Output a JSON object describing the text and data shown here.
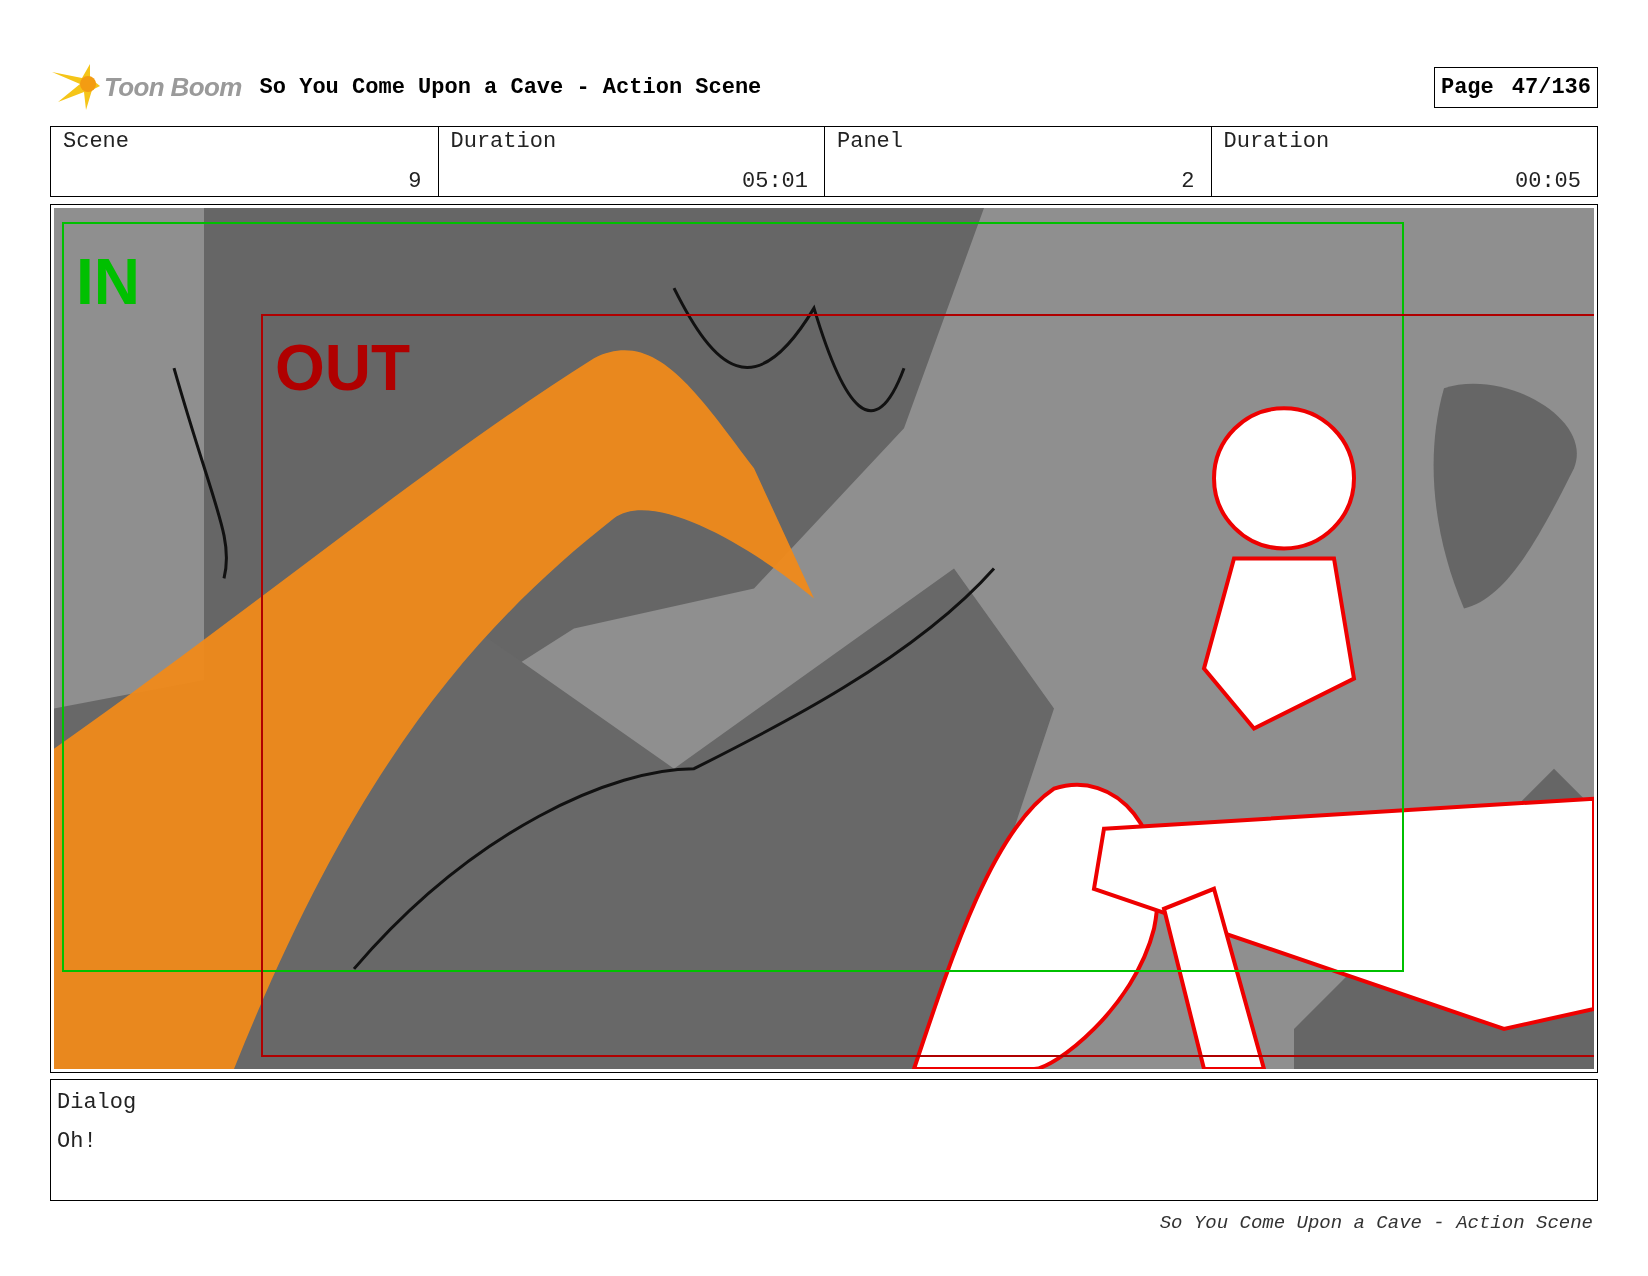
{
  "header": {
    "logo_text": "Toon Boom",
    "title": "So You Come Upon a Cave - Action Scene",
    "page_label": "Page",
    "page_number": "47/136"
  },
  "info": [
    {
      "label": "Scene",
      "value": "9"
    },
    {
      "label": "Duration",
      "value": "05:01"
    },
    {
      "label": "Panel",
      "value": "2"
    },
    {
      "label": "Duration",
      "value": "00:05"
    }
  ],
  "panel": {
    "camera_frames": [
      {
        "label": "IN",
        "color": "#00c000"
      },
      {
        "label": "OUT",
        "color": "#b00000"
      }
    ]
  },
  "dialog": {
    "label": "Dialog",
    "text": "Oh!"
  },
  "footer": "So You Come Upon a Cave - Action Scene"
}
